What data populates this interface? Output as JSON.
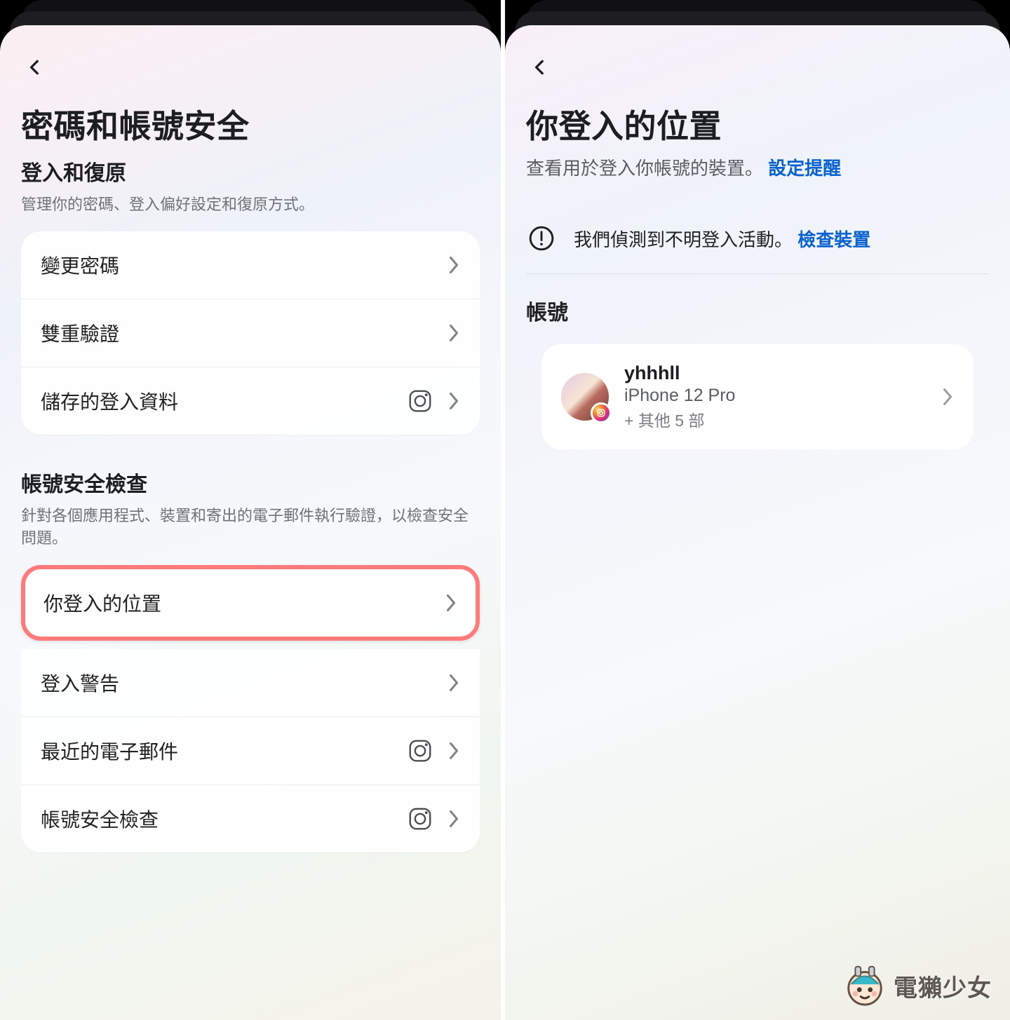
{
  "left": {
    "page_title": "密碼和帳號安全",
    "section1": {
      "heading": "登入和復原",
      "desc": "管理你的密碼、登入偏好設定和復原方式。",
      "rows": {
        "change_password": "變更密碼",
        "two_factor": "雙重驗證",
        "saved_login": "儲存的登入資料"
      }
    },
    "section2": {
      "heading": "帳號安全檢查",
      "desc": "針對各個應用程式、裝置和寄出的電子郵件執行驗證，以檢查安全問題。",
      "rows": {
        "where_logged_in": "你登入的位置",
        "login_alerts": "登入警告",
        "recent_emails": "最近的電子郵件",
        "security_checkup": "帳號安全檢查"
      }
    }
  },
  "right": {
    "page_title": "你登入的位置",
    "subtitle_text": "查看用於登入你帳號的裝置。 ",
    "subtitle_link": "設定提醒",
    "alert_text": "我們偵測到不明登入活動。 ",
    "alert_link": "檢查裝置",
    "account_heading": "帳號",
    "account": {
      "name": "yhhhll",
      "device": "iPhone 12 Pro",
      "more": "+ 其他 5 部"
    }
  },
  "watermark_text": "電獺少女"
}
